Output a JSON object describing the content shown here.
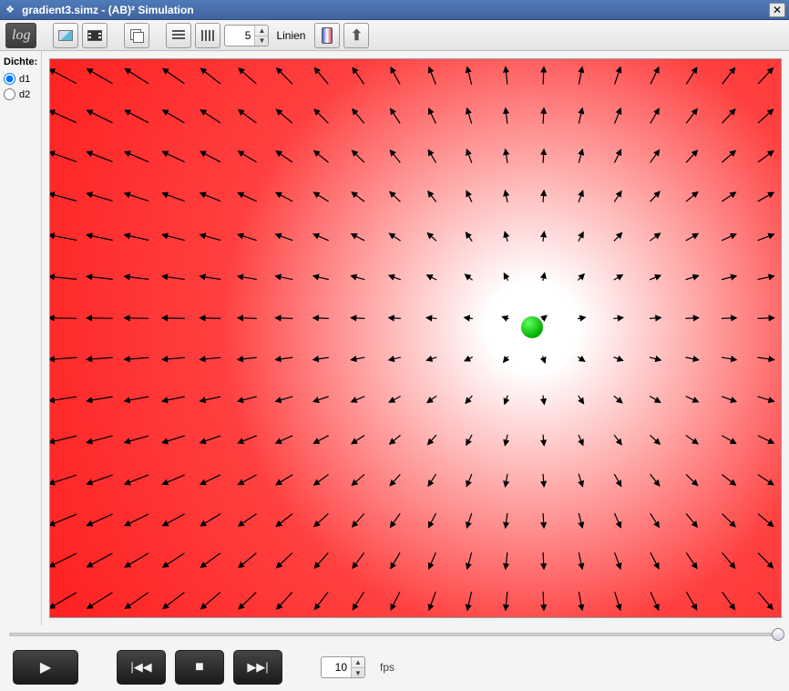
{
  "window": {
    "title": "gradient3.simz - (AB)² Simulation",
    "close_glyph": "✕"
  },
  "toolbar": {
    "log_label": "log",
    "spinner_value": "5",
    "linien_label": "Linien"
  },
  "sidebar": {
    "header": "Dichte:",
    "items": [
      {
        "id": "d1",
        "label": "d1",
        "checked": true
      },
      {
        "id": "d2",
        "label": "d2",
        "checked": false
      }
    ]
  },
  "chart_data": {
    "type": "vector_field",
    "title": "",
    "source_center": {
      "x": 0.66,
      "y": 0.48
    },
    "marker": {
      "color": "#00b000"
    },
    "cols": 20,
    "rows": 14,
    "description": "Arrows point radially outward from source_center; magnitude proportional to distance from center.",
    "background_colormap": "white-to-red radial, centered at source_center"
  },
  "playbar": {
    "fps_value": "10",
    "fps_label": "fps"
  },
  "icons": {
    "app": "❖",
    "play": "▶",
    "skip_start": "|◀◀",
    "stop": "■",
    "skip_end": "▶▶|",
    "spin_up": "▲",
    "spin_down": "▼",
    "upload_arrow": "⬆"
  }
}
